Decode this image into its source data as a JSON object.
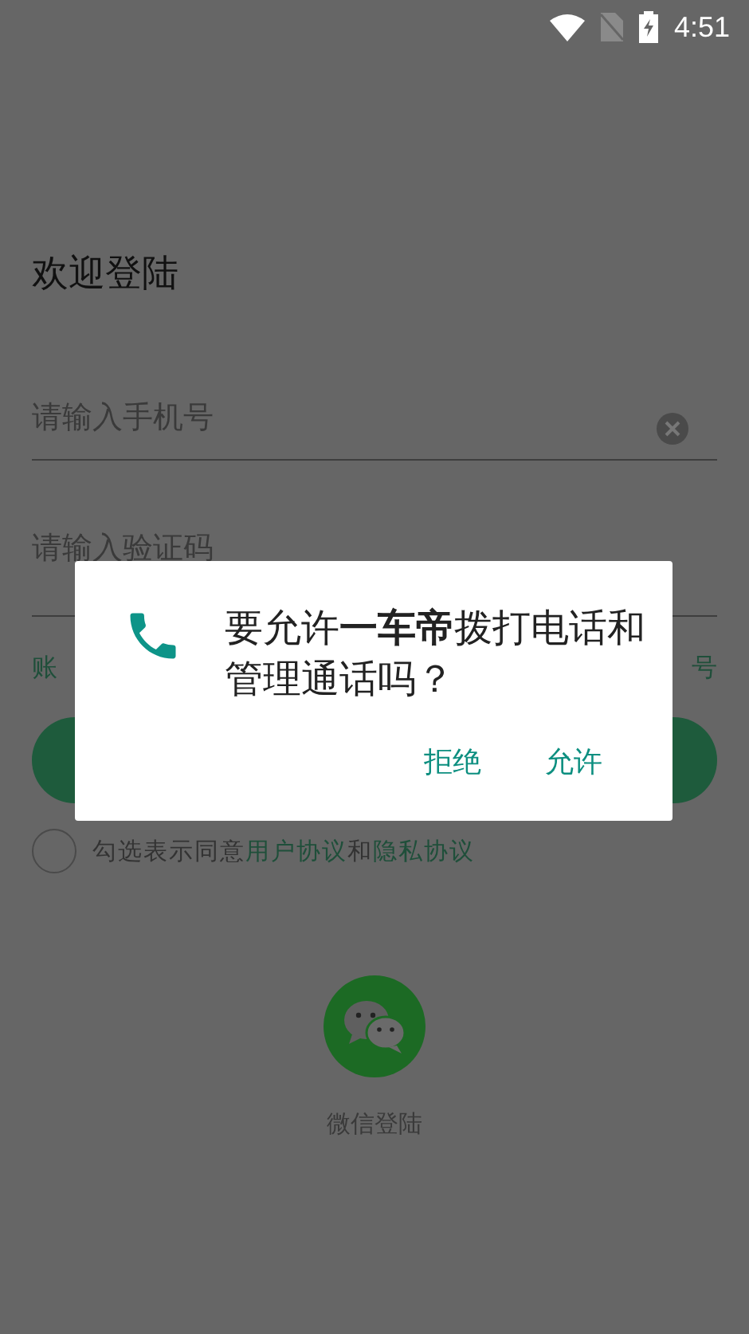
{
  "status_bar": {
    "time": "4:51"
  },
  "login": {
    "title": "欢迎登陆",
    "phone_field": {
      "placeholder": "请输入手机号"
    },
    "code_field": {
      "placeholder": "请输入验证码"
    },
    "links": [
      "账",
      "号"
    ],
    "agreement": {
      "checked": false,
      "parts": [
        {
          "kind": "plain",
          "text": "勾选表示同意"
        },
        {
          "kind": "link",
          "text": "用户协议"
        },
        {
          "kind": "plain",
          "text": "和"
        },
        {
          "kind": "link",
          "text": "隐私协议"
        }
      ]
    },
    "wechat_login": {
      "label": "微信登陆"
    }
  },
  "dialog": {
    "message": "要允许**一车帝**拨打电话和管理通话吗？",
    "buttons": [
      "拒绝",
      "允许"
    ]
  }
}
